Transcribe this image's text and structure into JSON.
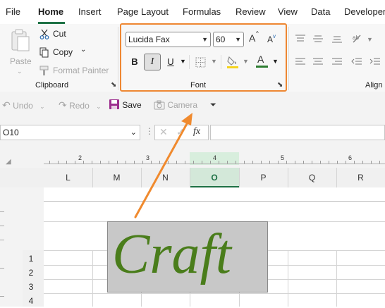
{
  "menu": {
    "file": "File",
    "home": "Home",
    "insert": "Insert",
    "page_layout": "Page Layout",
    "formulas": "Formulas",
    "review": "Review",
    "view": "View",
    "data": "Data",
    "developer": "Developer"
  },
  "clipboard": {
    "paste": "Paste",
    "cut": "Cut",
    "copy": "Copy",
    "format_painter": "Format Painter",
    "label": "Clipboard"
  },
  "font": {
    "name": "Lucida Fax",
    "size": "60",
    "bold": "B",
    "italic": "I",
    "underline": "U",
    "grow": "A",
    "shrink": "A",
    "color_letter": "A",
    "label": "Font",
    "color": "#2e7d32",
    "fill_color": "#f5d31e"
  },
  "alignment": {
    "label": "Align"
  },
  "qat": {
    "undo": "Undo",
    "redo": "Redo",
    "save": "Save",
    "camera": "Camera"
  },
  "formula_bar": {
    "name_box": "O10",
    "fx": "fx",
    "formula": ""
  },
  "ruler": {
    "marks": [
      "2",
      "3",
      "4",
      "5",
      "6"
    ]
  },
  "columns": [
    "L",
    "M",
    "N",
    "O",
    "P",
    "Q",
    "R"
  ],
  "rows": [
    "1",
    "2",
    "3",
    "4"
  ],
  "camera_image": {
    "text": "Craft",
    "text_color": "#4a7d1b",
    "background": "#c8c8c8"
  },
  "colors": {
    "accent": "#1e7145",
    "highlight": "#ee8732",
    "save_icon": "#9c2d8e"
  }
}
